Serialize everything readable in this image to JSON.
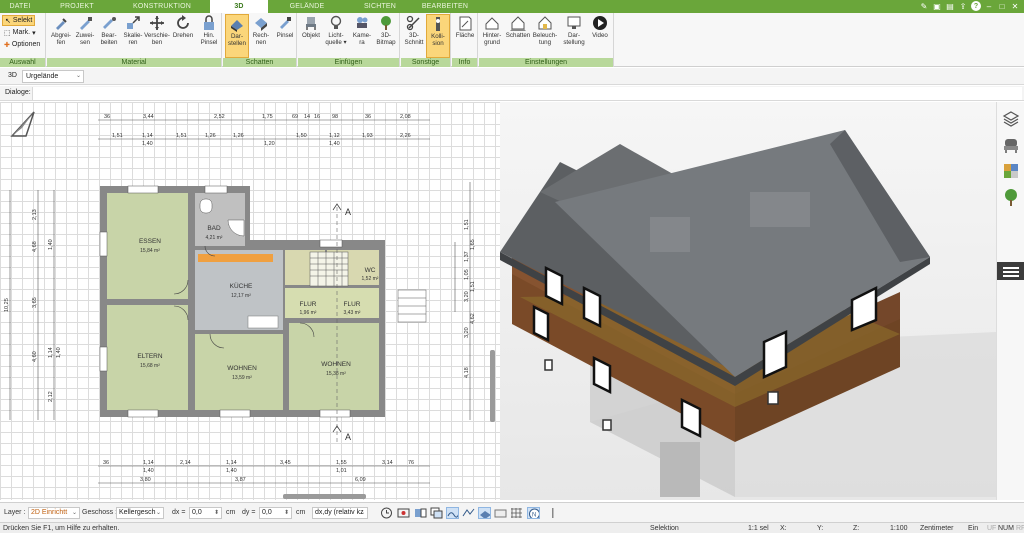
{
  "menu": {
    "tabs": [
      {
        "label": "DATEI",
        "w": 40
      },
      {
        "label": "PROJEKT",
        "w": 74
      },
      {
        "label": "KONSTRUKTION",
        "w": 96
      },
      {
        "label": "3D",
        "w": 58,
        "active": true
      },
      {
        "label": "GELÄNDE",
        "w": 78
      },
      {
        "label": "SICHTEN",
        "w": 68
      },
      {
        "label": "BEARBEITEN",
        "w": 62
      }
    ]
  },
  "ribbon": {
    "auswahl": {
      "label": "Auswahl",
      "selekt": "Selekt",
      "mark": "Mark.",
      "optionen": "Optionen"
    },
    "material": {
      "label": "Material",
      "buttons": [
        "Abgrei-\nfen",
        "Zuwei-\nsen",
        "Bear-\nbeiten",
        "Skalie-\nren",
        "Verschie-\nben",
        "Drehen",
        "Hin.\nPinsel"
      ]
    },
    "schatten": {
      "label": "Schatten",
      "buttons": [
        "Dar-\nstellen",
        "Rech-\nnen",
        "Pinsel"
      ]
    },
    "einfuegen": {
      "label": "Einfügen",
      "buttons": [
        "Objekt",
        "Licht-\nquelle ▾",
        "Kame-\nra",
        "3D-\nBitmap"
      ]
    },
    "sonstige": {
      "label": "Sonstige",
      "buttons": [
        "3D-\nSchnitt",
        "Kolli-\nsion"
      ]
    },
    "info": {
      "label": "Info",
      "buttons": [
        "Fläche"
      ]
    },
    "einstellungen": {
      "label": "Einstellungen",
      "buttons": [
        "Hinter-\ngrund",
        "Schatten",
        "Beleuch-\ntung",
        "Dar-\nstellung",
        "Video"
      ]
    }
  },
  "toolbar2": {
    "mode": "3D",
    "terrain": "Urgelände"
  },
  "dialog": {
    "label": "Dialoge:"
  },
  "plan": {
    "rooms": [
      {
        "name": "ESSEN",
        "area": "15,84 m²"
      },
      {
        "name": "BAD",
        "area": "4,21 m²"
      },
      {
        "name": "KÜCHE",
        "area": "12,17 m²"
      },
      {
        "name": "WC",
        "area": "1,52 m²"
      },
      {
        "name": "FLUR",
        "area": "1,96 m²"
      },
      {
        "name": "FLUR",
        "area": "3,43 m²"
      },
      {
        "name": "ELTERN",
        "area": "15,68 m²"
      },
      {
        "name": "WOHNEN",
        "area": "13,59 m²"
      },
      {
        "name": "WOHNEN",
        "area": "15,38 m²"
      }
    ],
    "top_dims_1": [
      "36",
      "3,44",
      "2,52",
      "1,75",
      "69",
      "14",
      "16",
      "98",
      "36",
      "2,08"
    ],
    "top_dims_2": [
      "1,51",
      "1,14",
      "1,51",
      "1,26",
      "1,26",
      "1,50",
      "1,12",
      "1,93",
      "2,26"
    ],
    "top_dims_2b": [
      "1,40",
      "1,20",
      "1,40"
    ],
    "bottom_dims_1": [
      "36",
      "1,14",
      "2,14",
      "1,14",
      "3,45",
      "1,55",
      "3,14",
      "76"
    ],
    "bottom_dims_1b": [
      "1,40",
      "1,40",
      "1,01"
    ],
    "bottom_dims_2": [
      "3,80",
      "3,87",
      "6,09"
    ],
    "left_dims": [
      "2,13",
      "3,65",
      "1,40",
      "10,25",
      "4,68",
      "4,60",
      "1,14",
      "2,12",
      "1,40"
    ],
    "right_dims": [
      "1,37",
      "1,05",
      "3,20",
      "1,51",
      "4,62",
      "4,18",
      "1,51",
      "3,20",
      "1,65"
    ],
    "section": "A"
  },
  "bottombar": {
    "layer_label": "Layer :",
    "layer_value": "2D Einrichtt",
    "geschoss_label": "Geschoss :",
    "geschoss_value": "Kellergesch",
    "dx_label": "dx =",
    "dx_value": "0,0",
    "dx_unit": "cm",
    "dy_label": "dy =",
    "dy_value": "0,0",
    "dy_unit": "cm",
    "mode_value": "dx,dy (relativ kz"
  },
  "status": {
    "hint": "Drücken Sie F1, um Hilfe zu erhalten.",
    "mode": "Selektion",
    "sel": "1:1 sel",
    "x": "X:",
    "y": "Y:",
    "z": "Z:",
    "scale": "1:100",
    "unit": "Zentimeter",
    "ein": "Ein",
    "uf": "UF",
    "num": "NUM",
    "rf": "RF"
  },
  "colors": {
    "accent": "#6aa63a",
    "ribbon_label": "#b8d89a",
    "selected": "#fbd67a",
    "roof": "#727578",
    "wall": "#7a4a28"
  }
}
